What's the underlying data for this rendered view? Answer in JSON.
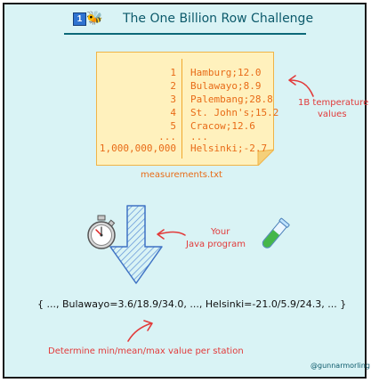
{
  "title": {
    "badge": "1",
    "text": "The One Billion Row Challenge"
  },
  "file": {
    "rows": [
      {
        "num": "1",
        "value": "Hamburg;12.0"
      },
      {
        "num": "2",
        "value": "Bulawayo;8.9"
      },
      {
        "num": "3",
        "value": "Palembang;28.8"
      },
      {
        "num": "4",
        "value": "St. John's;15.2"
      },
      {
        "num": "5",
        "value": "Cracow;12.6"
      },
      {
        "num": "...",
        "value": "..."
      },
      {
        "num": "1,000,000,000",
        "value": "Helsinki;-2.7"
      }
    ],
    "name": "measurements.txt"
  },
  "annotations": {
    "temperature_line1": "1B temperature",
    "temperature_line2": "values",
    "program_line1": "Your",
    "program_line2": "Java program",
    "determine": "Determine min/mean/max value per station"
  },
  "result": "{ ..., Bulawayo=3.6/18.9/34.0, ..., Helsinki=-21.0/5.9/24.3, ... }",
  "credit": "@gunnarmorling",
  "colors": {
    "background": "#d9f3f5",
    "title": "#0c5a6b",
    "note": "#fff1bd",
    "note_text": "#e86b17",
    "annotation": "#e23a3a",
    "arrow": "#5b8fd6"
  },
  "icons": {
    "title_badge": "number-one-icon",
    "title_bee": "bee-icon",
    "stopwatch": "stopwatch-icon",
    "test_tube": "test-tube-icon"
  }
}
